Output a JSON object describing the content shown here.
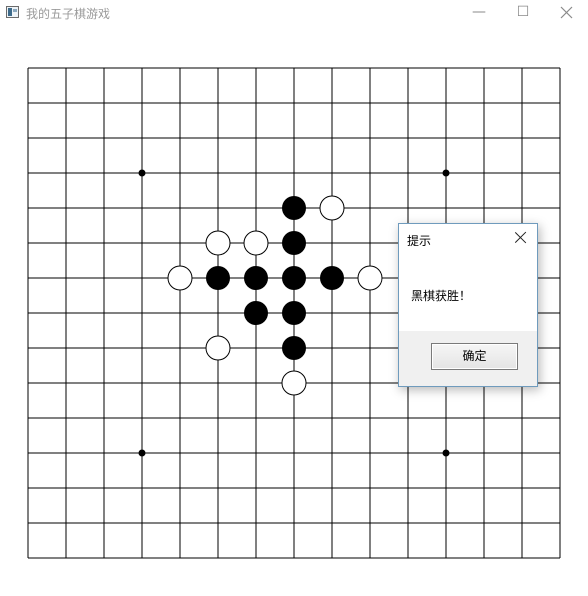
{
  "window": {
    "title": "我的五子棋游戏",
    "icon": "app-icon",
    "controls": {
      "minimize": "—",
      "maximize": "☐"
    }
  },
  "board": {
    "line_color": "#000000",
    "star_points": [
      [
        3,
        3
      ],
      [
        11,
        3
      ],
      [
        3,
        11
      ],
      [
        11,
        11
      ]
    ],
    "stones": {
      "black": [
        [
          7,
          4
        ],
        [
          7,
          5
        ],
        [
          5,
          6
        ],
        [
          6,
          6
        ],
        [
          7,
          6
        ],
        [
          8,
          6
        ],
        [
          6,
          7
        ],
        [
          7,
          7
        ],
        [
          7,
          8
        ]
      ],
      "white": [
        [
          8,
          4
        ],
        [
          5,
          5
        ],
        [
          6,
          5
        ],
        [
          4,
          6
        ],
        [
          9,
          6
        ],
        [
          5,
          8
        ],
        [
          7,
          9
        ]
      ]
    }
  },
  "dialog": {
    "title": "提示",
    "message": "黑棋获胜！",
    "ok_label": "确定"
  }
}
